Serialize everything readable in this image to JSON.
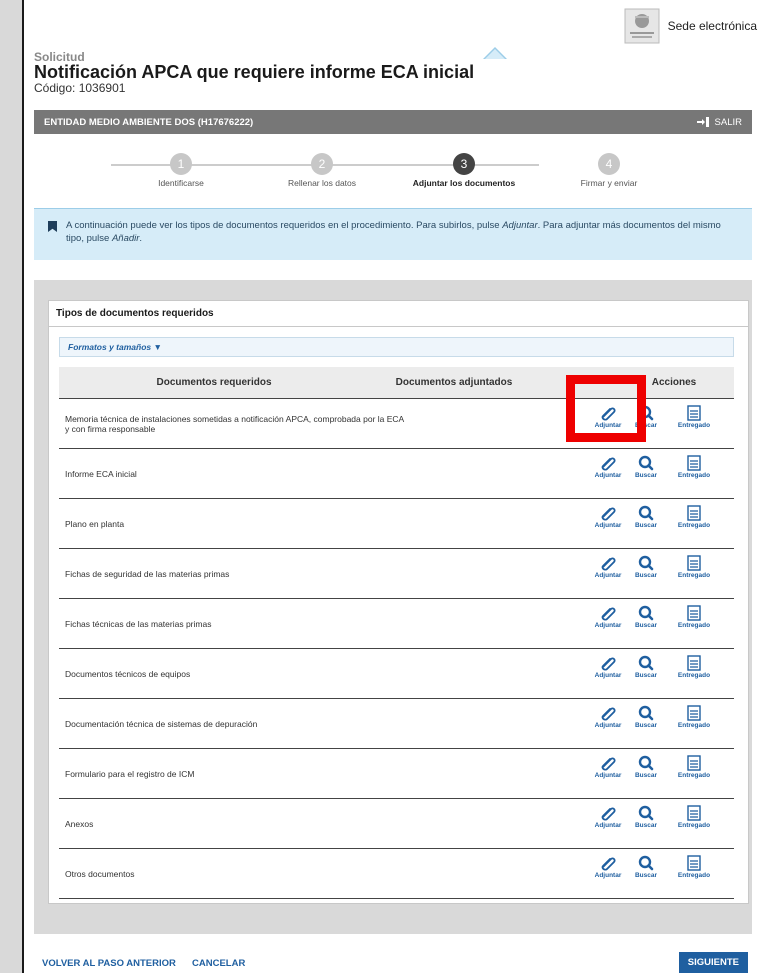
{
  "header": {
    "sede_label": "Sede electrónica",
    "logo_icon": "government-seal-icon"
  },
  "procedure": {
    "kicker": "Solicitud",
    "title": "Notificación APCA que requiere informe ECA inicial",
    "code": "Código: 1036901"
  },
  "entity_bar": {
    "entity": "ENTIDAD MEDIO AMBIENTE DOS (H17676222)",
    "exit_label": "SALIR",
    "exit_icon": "sign-out-icon"
  },
  "steps": [
    {
      "number": "1",
      "label": "Identificarse",
      "active": false
    },
    {
      "number": "2",
      "label": "Rellenar los datos",
      "active": false
    },
    {
      "number": "3",
      "label": "Adjuntar los documentos",
      "active": true
    },
    {
      "number": "4",
      "label": "Firmar y enviar",
      "active": false
    }
  ],
  "info": {
    "text_1": "A continuación puede ver los tipos de documentos requeridos en el procedimiento. Para subirlos, pulse ",
    "text_em_1": "Adjuntar",
    "text_2": ". Para adjuntar más documentos del mismo tipo, pulse ",
    "text_em_2": "Añadir",
    "text_3": "."
  },
  "card": {
    "title": "Tipos de documentos requeridos",
    "formats_label": "Formatos y tamaños ▼"
  },
  "table": {
    "headers": {
      "required": "Documentos requeridos",
      "attached": "Documentos adjuntados",
      "actions": "Acciones"
    },
    "action_labels": {
      "attach": "Adjuntar",
      "search": "Buscar",
      "delivered": "Entregado"
    },
    "rows": [
      "Memoria técnica de instalaciones sometidas a notificación APCA, comprobada por la ECA y con firma responsable",
      "Informe ECA inicial",
      "Plano en planta",
      "Fichas de seguridad de las materias primas",
      "Fichas técnicas de las materias primas",
      "Documentos técnicos de equipos",
      "Documentación técnica de sistemas de depuración",
      "Formulario para el registro de ICM",
      "Anexos",
      "Otros documentos"
    ]
  },
  "footer": {
    "back": "VOLVER AL PASO ANTERIOR",
    "cancel": "CANCELAR",
    "next": "SIGUIENTE"
  },
  "colors": {
    "accent": "#1f5fa0",
    "info_bg": "#d6ecf8",
    "entity_bar": "#777777",
    "highlight": "#ee0000"
  }
}
